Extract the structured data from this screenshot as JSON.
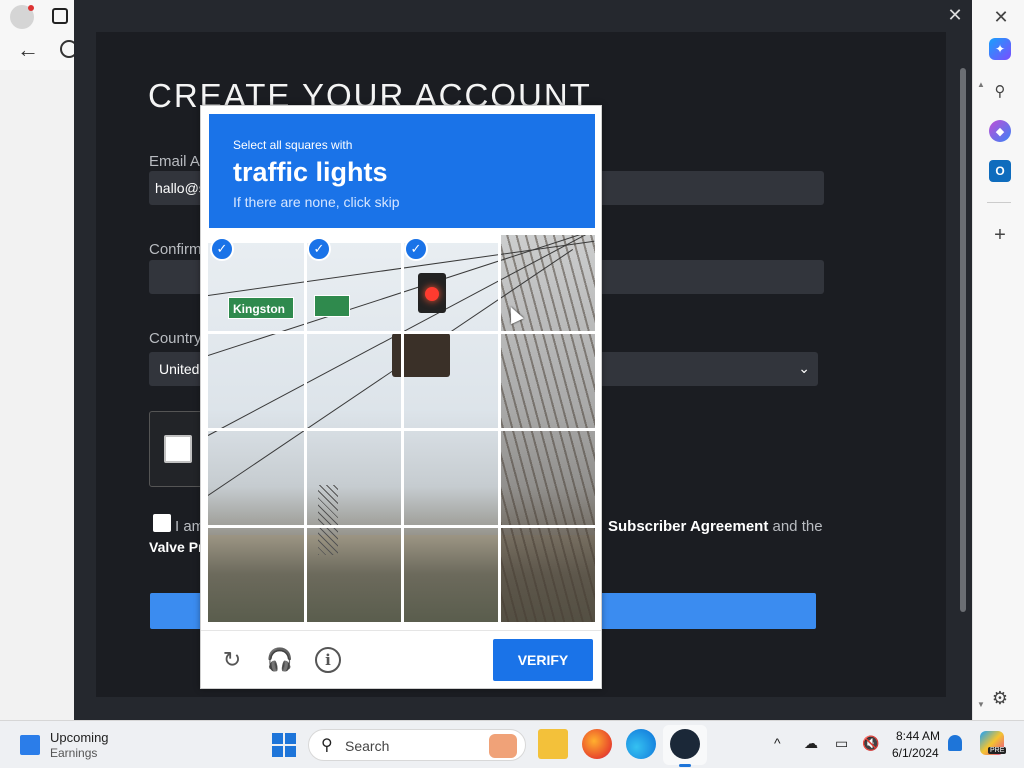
{
  "steam": {
    "title": "CREATE YOUR ACCOUNT",
    "email_label": "Email Ad",
    "email_value": "hallo@s",
    "confirm_label": "Confirm",
    "country_label": "Country",
    "country_value": "United",
    "agree_prefix": "I am",
    "agree_link": "Subscriber Agreement",
    "agree_suffix": "and the",
    "agree_line2": "Valve Pr",
    "close": "✕"
  },
  "captcha": {
    "instruction": "Select all squares with",
    "target": "traffic lights",
    "skip_hint": "If there are none, click skip",
    "street_sign": "Kingston",
    "verify_label": "VERIFY",
    "selected_tiles": [
      0,
      1,
      2
    ],
    "check_glyph": "✓",
    "reload_icon": "↻",
    "audio_icon": "🎧",
    "info_icon": "i"
  },
  "browser": {
    "back_icon": "←",
    "close_icon": "✕"
  },
  "sidebar": {
    "copilot": "✦",
    "search": "⚲",
    "m365": "◆",
    "outlook": "O",
    "add": "+",
    "settings": "⚙",
    "scroll_up": "▲",
    "scroll_down": "▼"
  },
  "taskbar": {
    "widget_title": "Upcoming",
    "widget_subtitle": "Earnings",
    "search_placeholder": "Search",
    "search_icon": "⚲",
    "tray_chevron": "^",
    "tray_cloud": "☁",
    "tray_monitor": "▭",
    "tray_speaker": "🔇",
    "time": "8:44 AM",
    "date": "6/1/2024",
    "copilot_badge": "PRE"
  },
  "colors": {
    "recaptcha_blue": "#1a73e8",
    "steam_background": "#1b1d22",
    "steam_button": "#3b8cf0"
  }
}
